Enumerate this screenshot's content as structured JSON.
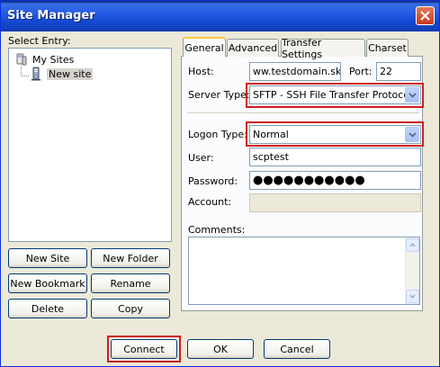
{
  "window": {
    "title": "Site Manager"
  },
  "left": {
    "select_entry_label": "Select Entry:",
    "tree": {
      "root": "My Sites",
      "child": "New site"
    },
    "buttons": {
      "new_site": "New Site",
      "new_folder": "New Folder",
      "new_bookmark": "New Bookmark",
      "rename": "Rename",
      "delete": "Delete",
      "copy": "Copy"
    }
  },
  "tabs": [
    "General",
    "Advanced",
    "Transfer Settings",
    "Charset"
  ],
  "general": {
    "host_label": "Host:",
    "host_value": "ww.testdomain.sk",
    "port_label": "Port:",
    "port_value": "22",
    "server_type_label": "Server Type:",
    "server_type_value": "SFTP - SSH File Transfer Protocol",
    "logon_type_label": "Logon Type:",
    "logon_type_value": "Normal",
    "user_label": "User:",
    "user_value": "scptest",
    "password_label": "Password:",
    "password_value": "●●●●●●●●●●●",
    "account_label": "Account:",
    "account_value": "",
    "comments_label": "Comments:"
  },
  "footer": {
    "connect": "Connect",
    "ok": "OK",
    "cancel": "Cancel"
  },
  "colors": {
    "highlight": "#cc1f1f",
    "titlebar": "#2058e3"
  }
}
